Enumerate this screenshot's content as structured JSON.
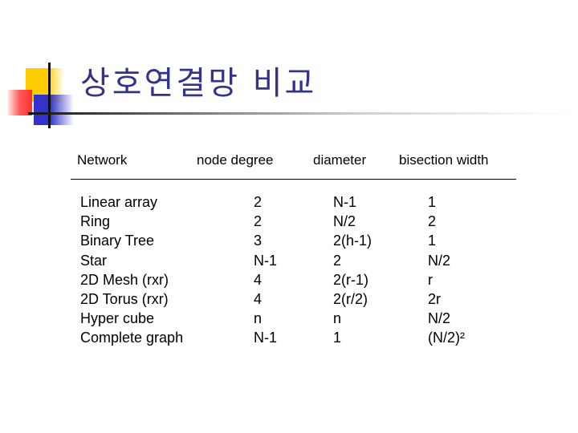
{
  "title": "상호연결망 비교",
  "colors": {
    "title": "#333388",
    "deco_yellow": "#ffcc00",
    "deco_blue": "#3333cc",
    "deco_red": "#ff3333"
  },
  "table": {
    "headers": [
      "Network",
      "node degree",
      "diameter",
      "bisection width"
    ],
    "rows": [
      {
        "network": "Linear array",
        "degree": "2",
        "diameter": "N-1",
        "bisection": "1"
      },
      {
        "network": "Ring",
        "degree": "2",
        "diameter": "N/2",
        "bisection": "2"
      },
      {
        "network": "Binary Tree",
        "degree": "3",
        "diameter": "2(h-1)",
        "bisection": "1"
      },
      {
        "network": "Star",
        "degree": "N-1",
        "diameter": "2",
        "bisection": "N/2"
      },
      {
        "network": "2D Mesh (rxr)",
        "degree": "4",
        "diameter": "2(r-1)",
        "bisection": "r"
      },
      {
        "network": "2D Torus (rxr)",
        "degree": "4",
        "diameter": "2(r/2)",
        "bisection": "2r"
      },
      {
        "network": "Hyper cube",
        "degree": "n",
        "diameter": "n",
        "bisection": "N/2"
      },
      {
        "network": "Complete graph",
        "degree": "N-1",
        "diameter": "1",
        "bisection": "(N/2)²"
      }
    ]
  }
}
